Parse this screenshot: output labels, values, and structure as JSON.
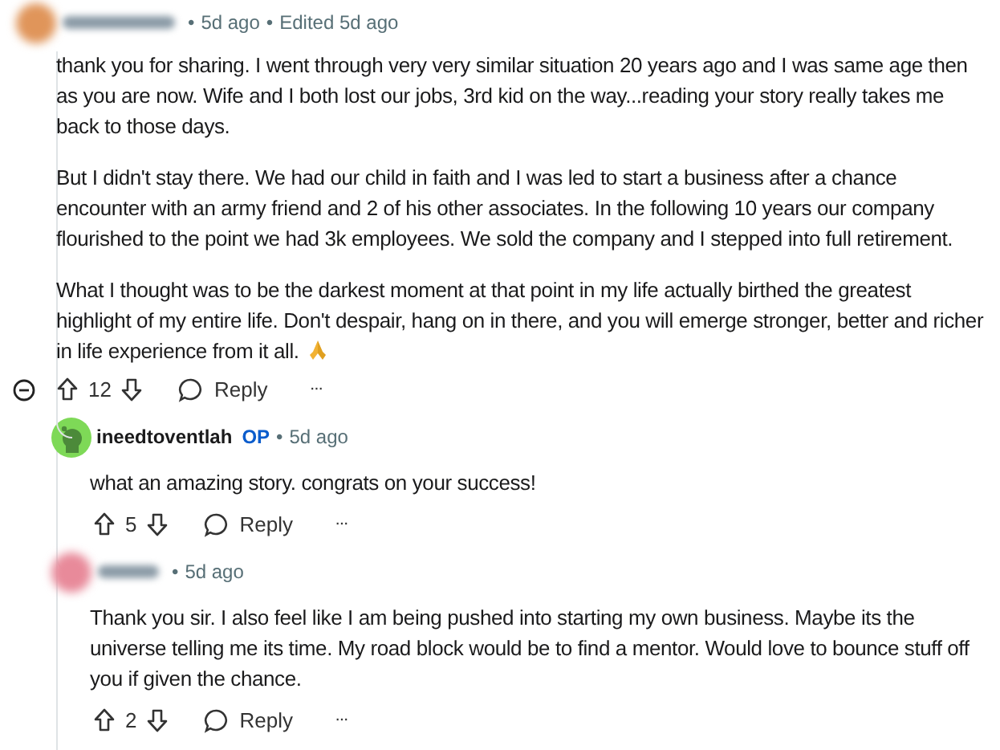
{
  "comment": {
    "avatar": {
      "kind": "blurred",
      "color": "#e0955a"
    },
    "dot": "•",
    "time": "5d ago",
    "dot2": "•",
    "edited": "Edited 5d ago",
    "paragraphs": [
      "thank you for sharing. I went through very very similar situation 20 years ago and I was same age then as you are now. Wife and I both lost our jobs, 3rd kid on the way...reading your story really takes me back to those days.",
      "But I didn't stay there. We had our child in faith and I was led to start a business after a chance encounter with an army friend and 2 of his other associates. In the following 10 years our company flourished to the point we had 3k employees. We sold the company and I stepped into full retirement.",
      "What I thought was to be the darkest moment at that point in my life actually birthed the greatest highlight of my entire life. Don't despair, hang on in there, and you will emerge stronger, better and richer in life experience from it all."
    ],
    "score": "12",
    "reply": "Reply",
    "more": "···",
    "replies": [
      {
        "avatar": {
          "kind": "snoo",
          "color": "#7ed957"
        },
        "author": "ineedtoventlah",
        "badge": "OP",
        "dot": "•",
        "time": "5d ago",
        "paragraphs": [
          "what an amazing story. congrats on your success!"
        ],
        "score": "5",
        "reply": "Reply",
        "more": "···"
      },
      {
        "avatar": {
          "kind": "blurred",
          "color": "#e88a9a"
        },
        "dot": "•",
        "time": "5d ago",
        "paragraphs": [
          "Thank you sir. I also feel like I am being pushed into starting my own business. Maybe its the universe telling me its time. My road block would be to find a mentor. Would love to bounce stuff off you if given the chance."
        ],
        "score": "2",
        "reply": "Reply",
        "more": "···"
      }
    ]
  }
}
